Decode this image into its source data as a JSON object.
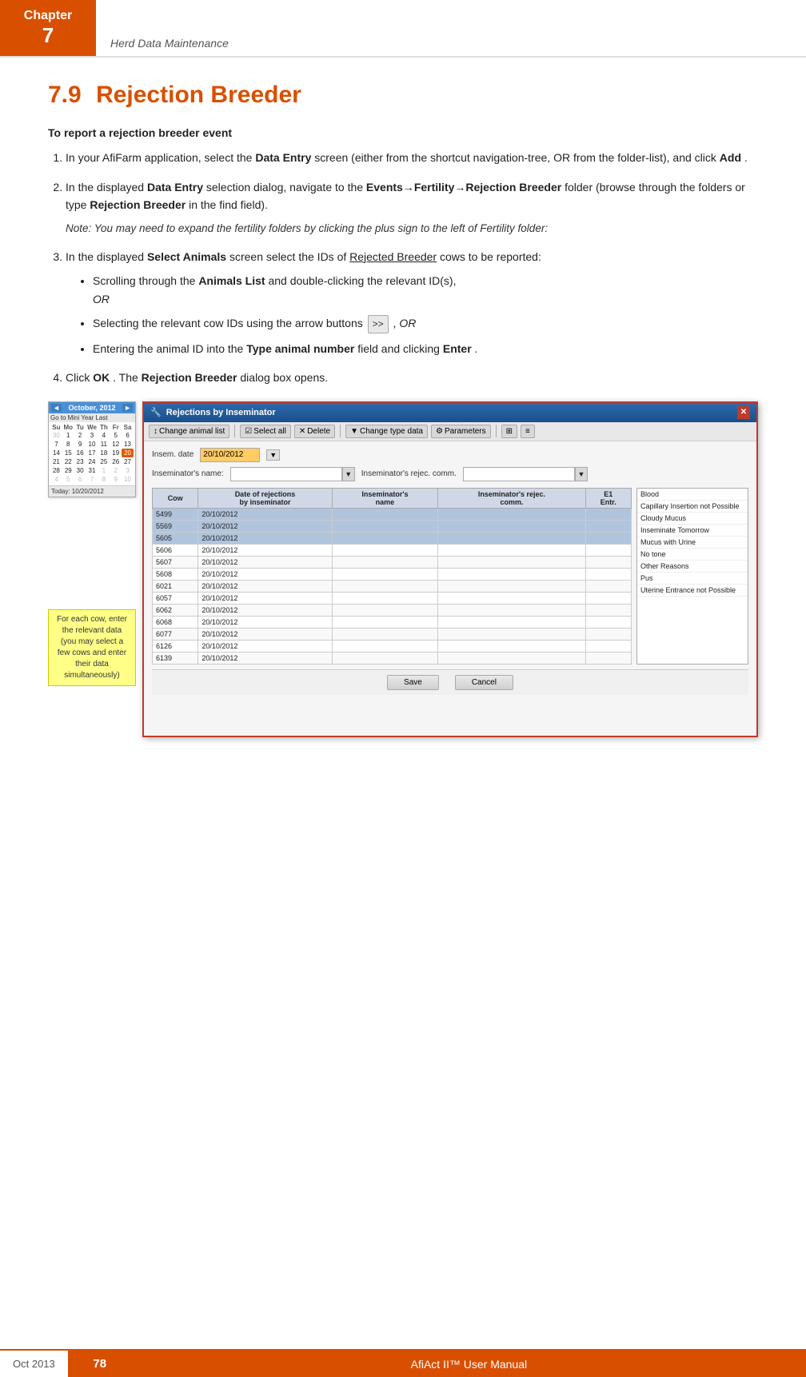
{
  "header": {
    "chapter_label": "Chapter",
    "chapter_num": "7",
    "subtitle": "Herd Data Maintenance"
  },
  "section": {
    "num": "7.9",
    "title": "Rejection Breeder"
  },
  "instructions": {
    "intro_bold": "To report a rejection breeder event",
    "step1": {
      "text": "In your AfiFarm application, select the ",
      "bold1": "Data Entry",
      "text2": " screen (either from the shortcut navigation-tree, OR from the folder-list), and click ",
      "bold2": "Add",
      "text3": "."
    },
    "step2": {
      "text": "In the displayed ",
      "bold1": "Data Entry",
      "text2": " selection dialog, navigate to the ",
      "bold2": "Events",
      "arrow": "→",
      "bold3": "Fertility",
      "arrow2": "→",
      "bold4": "Rejection Breeder",
      "text3": " folder (browse through the folders or type ",
      "bold5": "Rejection Breeder",
      "text4": " in the find field)."
    },
    "step2_note": "Note: You may need to expand the fertility folders by clicking the plus sign to the left of Fertility folder:",
    "step3": {
      "text": "In the displayed ",
      "bold1": "Select Animals",
      "text2": " screen select the IDs of ",
      "underline": "Rejected Breeder",
      "text3": " cows to be reported:"
    },
    "bullet1": {
      "text": "Scrolling through the ",
      "bold": "Animals List",
      "text2": " and double-clicking the relevant ID(s),",
      "italic": "OR"
    },
    "bullet2": {
      "text": "Selecting the relevant cow IDs using the arrow buttons",
      "btn_label": ">>",
      "italic": ", OR"
    },
    "bullet3": {
      "text": "Entering the animal ID into the ",
      "bold": "Type animal number",
      "text2": " field and clicking ",
      "bold2": "Enter",
      "text3": "."
    },
    "step4": {
      "text": "Click ",
      "bold1": "OK",
      "text2": ". The ",
      "bold2": "Rejection Breeder",
      "text3": " dialog box opens."
    }
  },
  "calendar": {
    "title": "October, 2012",
    "toolbar": [
      "Go to",
      "Mini",
      "Year",
      "Mini",
      "Go",
      "Last"
    ],
    "days_header": [
      "Su",
      "Mo",
      "Tu",
      "We",
      "Th",
      "Fr",
      "Sa"
    ],
    "weeks": [
      [
        "30",
        "1",
        "2",
        "3",
        "4",
        "5",
        "6"
      ],
      [
        "7",
        "8",
        "9",
        "10",
        "11",
        "12",
        "13"
      ],
      [
        "14",
        "15",
        "16",
        "17",
        "18",
        "19",
        "20"
      ],
      [
        "21",
        "22",
        "23",
        "24",
        "25",
        "26",
        "27"
      ],
      [
        "28",
        "29",
        "30",
        "31",
        "1",
        "2",
        "3"
      ],
      [
        "4",
        "5",
        "6",
        "7",
        "8",
        "9",
        "10"
      ]
    ],
    "today_label": "Today: 10/20/2012",
    "today_day": "20",
    "other_month": [
      "30",
      "1",
      "2",
      "3",
      "4",
      "5",
      "6",
      "1",
      "2",
      "3",
      "4",
      "5",
      "6",
      "7",
      "8",
      "9",
      "10"
    ]
  },
  "annotation": {
    "text": "For each cow, enter the relevant data (you may select a few cows and enter their data simultaneously)"
  },
  "dialog": {
    "title": "Rejections by Inseminator",
    "toolbar_buttons": [
      "Change animal list",
      "Select all",
      "Delete",
      "Change type data",
      "Parameters"
    ],
    "insem_date_label": "Insem. date",
    "insem_date_value": "20/10/2012",
    "insem_name_label": "Inseminator's name:",
    "insem_rejec_label": "Inseminator's rejec. comm.",
    "table_headers": [
      "Cow",
      "Date of rejections by inseminator",
      "Inseminator's name",
      "Inseminator's rejec. comm.",
      "E1 Entr."
    ],
    "table_rows": [
      {
        "cow": "5499",
        "date": "20/10/2012",
        "insem": "",
        "rejec": "",
        "e1": ""
      },
      {
        "cow": "5569",
        "date": "20/10/2012",
        "insem": "",
        "rejec": "",
        "e1": ""
      },
      {
        "cow": "5605",
        "date": "20/10/2012",
        "insem": "",
        "rejec": "",
        "e1": ""
      },
      {
        "cow": "5606",
        "date": "20/10/2012",
        "insem": "",
        "rejec": "",
        "e1": ""
      },
      {
        "cow": "5607",
        "date": "20/10/2012",
        "insem": "",
        "rejec": "",
        "e1": ""
      },
      {
        "cow": "5608",
        "date": "20/10/2012",
        "insem": "",
        "rejec": "",
        "e1": ""
      },
      {
        "cow": "6021",
        "date": "20/10/2012",
        "insem": "",
        "rejec": "",
        "e1": ""
      },
      {
        "cow": "6057",
        "date": "20/10/2012",
        "insem": "",
        "rejec": "",
        "e1": ""
      },
      {
        "cow": "6062",
        "date": "20/10/2012",
        "insem": "",
        "rejec": "",
        "e1": ""
      },
      {
        "cow": "6068",
        "date": "20/10/2012",
        "insem": "",
        "rejec": "",
        "e1": ""
      },
      {
        "cow": "6077",
        "date": "20/10/2012",
        "insem": "",
        "rejec": "",
        "e1": ""
      },
      {
        "cow": "6126",
        "date": "20/10/2012",
        "insem": "",
        "rejec": "",
        "e1": ""
      },
      {
        "cow": "6139",
        "date": "20/10/2012",
        "insem": "",
        "rejec": "",
        "e1": ""
      }
    ],
    "rejection_list": [
      "Blood",
      "Capillary Insertion not Possible",
      "Cloudy Mucus",
      "Inseminate Tomorrow",
      "Mucus with Urine",
      "No tone",
      "Other Reasons",
      "Pus",
      "Uterine Entrance not Possible"
    ],
    "save_btn": "Save",
    "cancel_btn": "Cancel"
  },
  "footer": {
    "page_num": "78",
    "manual_title": "AfiAct II™ User Manual",
    "date": "Oct 2013"
  }
}
